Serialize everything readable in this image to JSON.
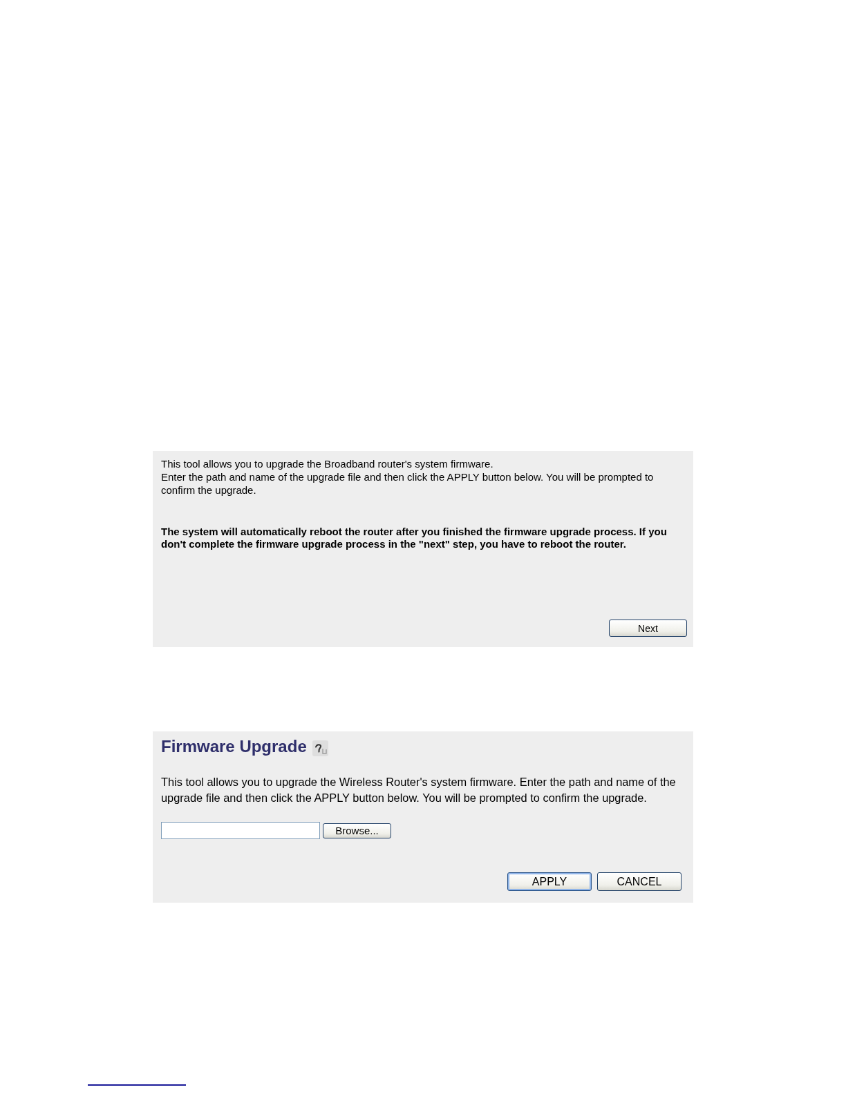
{
  "wizard_step": {
    "intro": "This tool allows you to upgrade the Broadband router's system firmware.",
    "instructions": "Enter the path and name of the upgrade file and then click the APPLY button below. You will be prompted to confirm the upgrade.",
    "warning": "The system will automatically reboot the router after you finished the firmware upgrade process. If you don't complete the firmware upgrade process in the \"next\" step, you have to reboot the router.",
    "next_button": "Next"
  },
  "firmware_upgrade": {
    "title": "Firmware Upgrade",
    "description": "This tool allows you to upgrade the Wireless Router's system firmware. Enter the path and name of the upgrade file and then click the APPLY button below. You will be prompted to confirm the upgrade.",
    "browse_button": "Browse...",
    "buttons": [
      {
        "label": "APPLY",
        "default": true
      },
      {
        "label": "CANCEL",
        "default": false
      }
    ]
  }
}
